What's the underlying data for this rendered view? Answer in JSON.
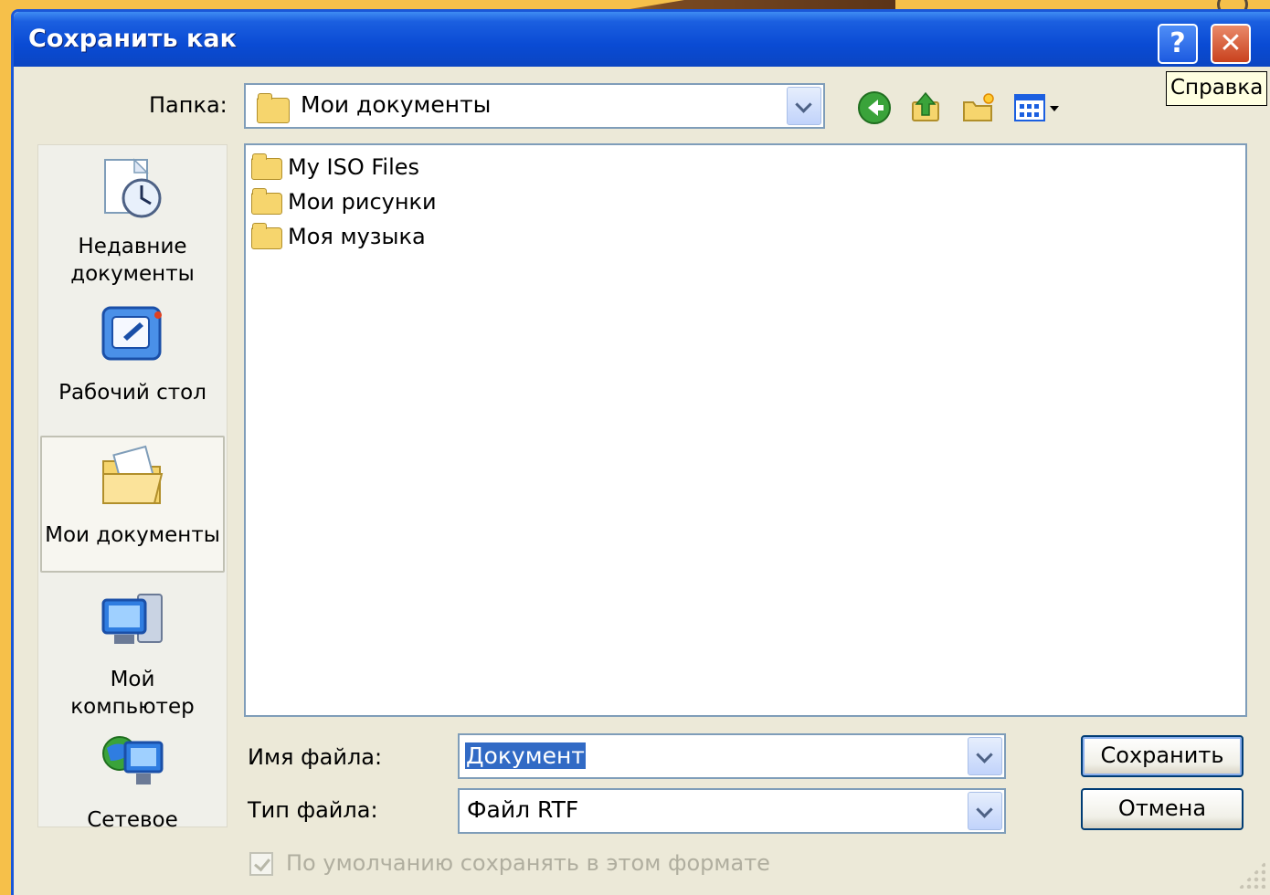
{
  "window": {
    "title": "Сохранить как",
    "help_symbol": "?",
    "close_symbol": "✕",
    "tooltip": "Справка"
  },
  "location": {
    "label": "Папка:",
    "value": "Мои документы",
    "icon": "documents-folder-icon"
  },
  "toolbar": {
    "icons": [
      "back-icon",
      "up-folder-icon",
      "new-folder-icon",
      "view-menu-icon"
    ]
  },
  "places": [
    {
      "label": "Недавние документы",
      "icon": "recent-documents-icon",
      "selected": false
    },
    {
      "label": "Рабочий стол",
      "icon": "desktop-icon",
      "selected": false
    },
    {
      "label": "Мои документы",
      "icon": "my-documents-icon",
      "selected": true
    },
    {
      "label": "Мой компьютер",
      "icon": "my-computer-icon",
      "selected": false
    },
    {
      "label": "Сетевое",
      "icon": "network-icon",
      "selected": false
    }
  ],
  "files": [
    {
      "name": "My ISO Files",
      "icon": "folder-icon"
    },
    {
      "name": "Мои рисунки",
      "icon": "pictures-folder-icon"
    },
    {
      "name": "Моя музыка",
      "icon": "music-folder-icon"
    }
  ],
  "filename": {
    "label": "Имя файла:",
    "value": "Документ"
  },
  "filetype": {
    "label": "Тип файла:",
    "value": "Файл RTF"
  },
  "buttons": {
    "save": "Сохранить",
    "cancel": "Отмена"
  },
  "checkbox": {
    "label": "По умолчанию сохранять в этом формате",
    "checked": true,
    "disabled": true
  },
  "colors": {
    "titlebar": "#0a4bd4",
    "dialog_bg": "#ece9d8",
    "selection": "#316ac5",
    "desktop_bg": "#f6c04a"
  }
}
